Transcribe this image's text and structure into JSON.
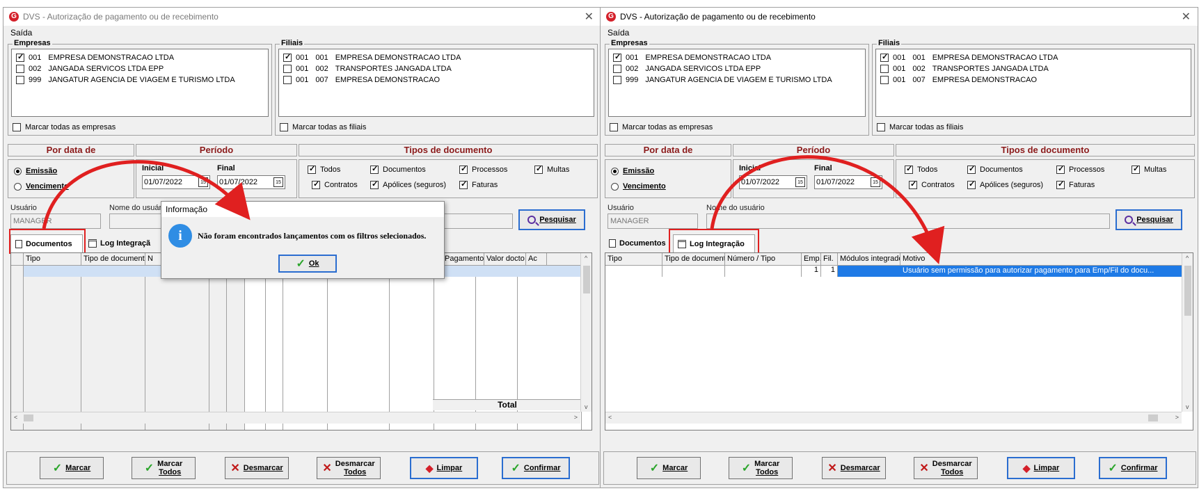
{
  "window": {
    "title": "DVS - Autorização de pagamento ou de recebimento",
    "menu": "Saída"
  },
  "empresas": {
    "label": "Empresas",
    "items": [
      {
        "code": "001",
        "name": "EMPRESA DEMONSTRACAO LTDA",
        "checked": true
      },
      {
        "code": "002",
        "name": "JANGADA SERVICOS LTDA EPP",
        "checked": false
      },
      {
        "code": "999",
        "name": "JANGATUR AGENCIA DE VIAGEM E TURISMO LTDA",
        "checked": false
      }
    ],
    "mark_all": "Marcar todas as empresas"
  },
  "filiais": {
    "label": "Filiais",
    "items": [
      {
        "code": "001",
        "sub": "001",
        "name": "EMPRESA DEMONSTRACAO LTDA",
        "checked": true
      },
      {
        "code": "001",
        "sub": "002",
        "name": "TRANSPORTES JANGADA LTDA",
        "checked": false
      },
      {
        "code": "001",
        "sub": "007",
        "name": "EMPRESA DEMONSTRACAO",
        "checked": false
      }
    ],
    "mark_all": "Marcar todas as filiais"
  },
  "por_data": {
    "header": "Por data de",
    "emissao": "Emissão",
    "vencimento": "Vencimento"
  },
  "periodo": {
    "header": "Período",
    "inicial_label": "Inicial",
    "final_label": "Final",
    "inicial": "01/07/2022",
    "final": "01/07/2022"
  },
  "tipos": {
    "header": "Tipos de documento",
    "todos": "Todos",
    "documentos": "Documentos",
    "processos": "Processos",
    "multas": "Multas",
    "contratos": "Contratos",
    "apolices": "Apólices (seguros)",
    "faturas": "Faturas"
  },
  "usuario": {
    "label": "Usuário",
    "value": "MANAGER",
    "nome_label": "Nome do usuário",
    "nome_label_truncated": "Nome do usuári"
  },
  "pesquisar": "Pesquisar",
  "tabs": {
    "documentos": "Documentos",
    "log": "Log Integração",
    "log_truncated": "Log Integraçã"
  },
  "doc_grid": {
    "headers": [
      "Tipo",
      "Tipo de documento",
      "N",
      "",
      "",
      "",
      "",
      "",
      "cimento",
      "Pagamento",
      "Valor docto",
      "Ac"
    ],
    "total": "Total"
  },
  "log_grid": {
    "headers": [
      "Tipo",
      "Tipo de documento",
      "Número / Tipo",
      "Emp.",
      "Fil.",
      "Módulos integrados",
      "Motivo"
    ],
    "row": {
      "emp": "1",
      "fil": "1",
      "motivo": "Usuário sem permissão para autorizar pagamento para Emp/Fil do docu..."
    }
  },
  "dialog": {
    "title": "Informação",
    "message": "Não foram encontrados lançamentos com os filtros selecionados.",
    "ok": "Ok"
  },
  "buttons": {
    "marcar": "Marcar",
    "marcar_todos_1": "Marcar",
    "marcar_todos_2": "Todos",
    "desmarcar": "Desmarcar",
    "desmarcar_todos_1": "Desmarcar",
    "desmarcar_todos_2": "Todos",
    "limpar": "Limpar",
    "confirmar": "Confirmar"
  },
  "icons": {
    "check": "✓",
    "x": "✕",
    "eraser": "◆",
    "info": "i",
    "close": "✕",
    "app": "G",
    "calendar": "15",
    "scroll_left": "<",
    "scroll_right": ">",
    "scroll_up": "^",
    "scroll_down": "v"
  },
  "colors": {
    "header_text": "#8b1a1a",
    "highlight": "#e02020",
    "selection": "#1e7ae6",
    "info": "#2f8de4"
  }
}
